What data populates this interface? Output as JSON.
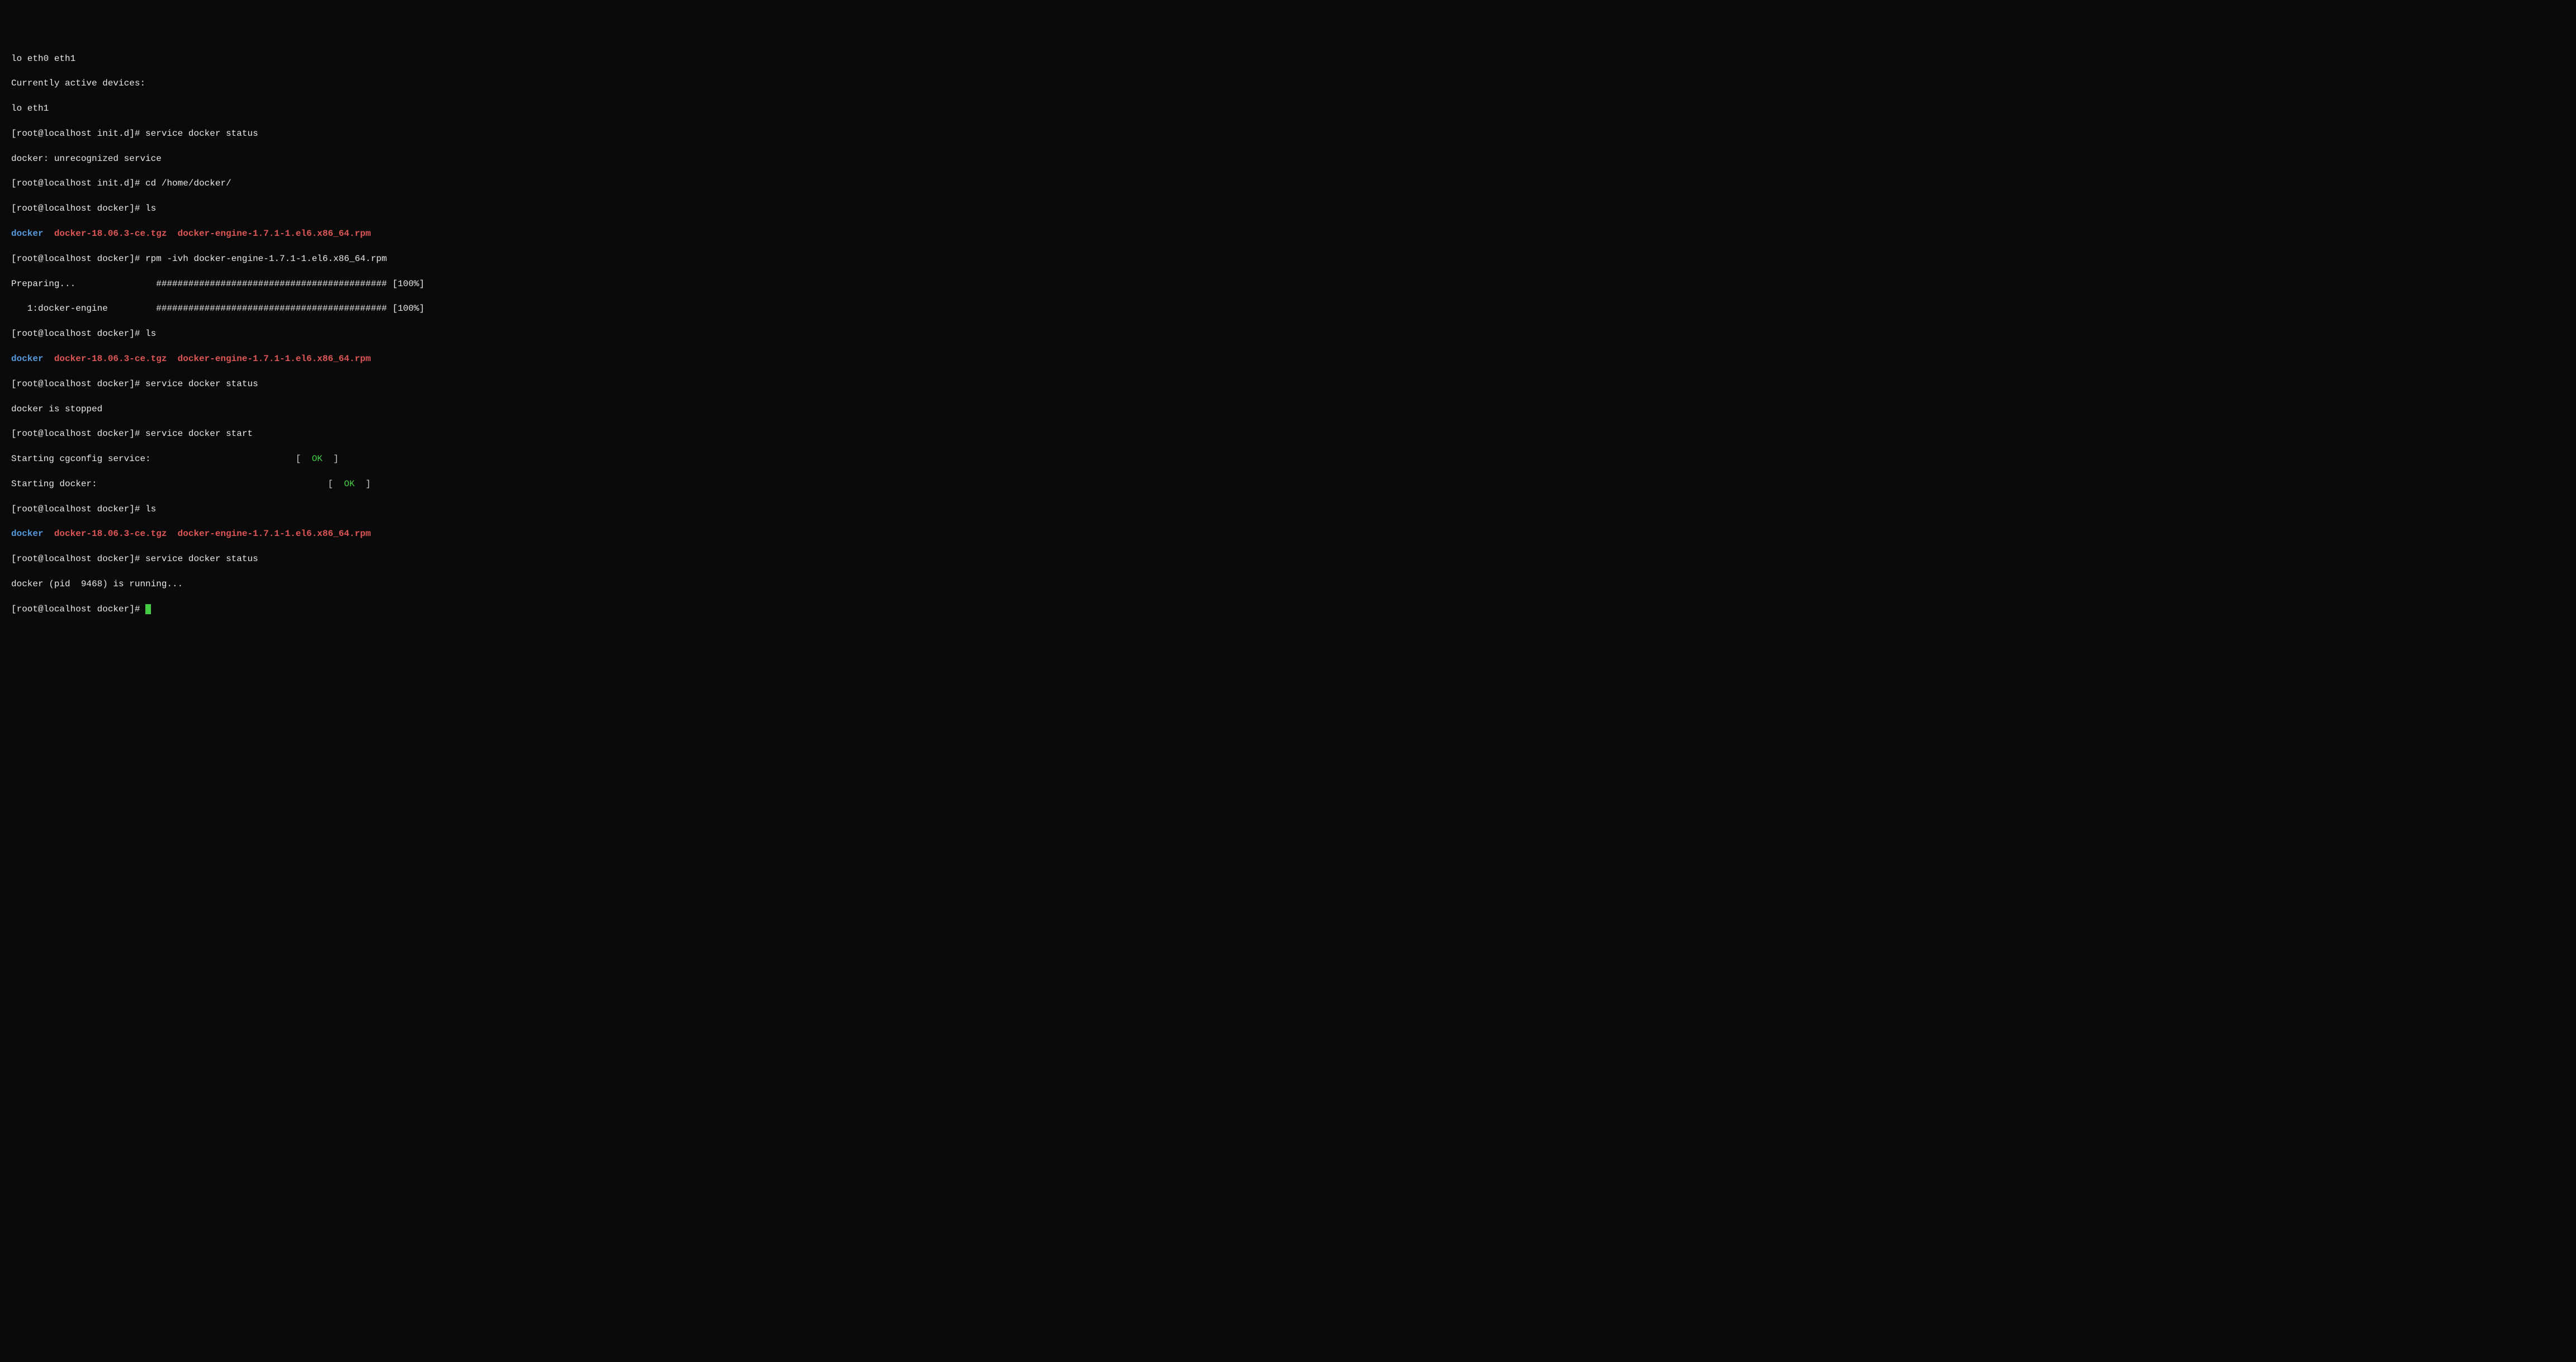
{
  "lines": {
    "l1": "lo eth0 eth1",
    "l2": "Currently active devices:",
    "l3": "lo eth1",
    "l4_prompt": "[root@localhost init.d]# ",
    "l4_cmd": "service docker status",
    "l5": "docker: unrecognized service",
    "l6_prompt": "[root@localhost init.d]# ",
    "l6_cmd": "cd /home/docker/",
    "l7_prompt": "[root@localhost docker]# ",
    "l7_cmd": "ls",
    "l8_docker": "docker",
    "l8_tgz": "  docker-18.06.3-ce.tgz  ",
    "l8_rpm": "docker-engine-1.7.1-1.el6.x86_64.rpm",
    "l9_prompt": "[root@localhost docker]# ",
    "l9_cmd": "rpm -ivh docker-engine-1.7.1-1.el6.x86_64.rpm",
    "l10_label": "Preparing...               ",
    "l10_bar": "########################################### [100%]",
    "l11_label": "   1:docker-engine         ",
    "l11_bar": "########################################### [100%]",
    "l12_prompt": "[root@localhost docker]# ",
    "l12_cmd": "ls",
    "l13_docker": "docker",
    "l13_tgz": "  docker-18.06.3-ce.tgz  ",
    "l13_rpm": "docker-engine-1.7.1-1.el6.x86_64.rpm",
    "l14_prompt": "[root@localhost docker]# ",
    "l14_cmd": "service docker status",
    "l15": "docker is stopped",
    "l16_prompt": "[root@localhost docker]# ",
    "l16_cmd": "service docker start",
    "l17_label": "Starting cgconfig service:                           ",
    "l17_lb": "[  ",
    "l17_ok": "OK",
    "l17_rb": "  ]",
    "l18_label": "Starting docker: \t                                   ",
    "l18_lb": "[  ",
    "l18_ok": "OK",
    "l18_rb": "  ]",
    "l19_prompt": "[root@localhost docker]# ",
    "l19_cmd": "ls",
    "l20_docker": "docker",
    "l20_tgz": "  docker-18.06.3-ce.tgz  ",
    "l20_rpm": "docker-engine-1.7.1-1.el6.x86_64.rpm",
    "l21_prompt": "[root@localhost docker]# ",
    "l21_cmd": "service docker status",
    "l22": "docker (pid  9468) is running...",
    "l23_prompt": "[root@localhost docker]# "
  }
}
